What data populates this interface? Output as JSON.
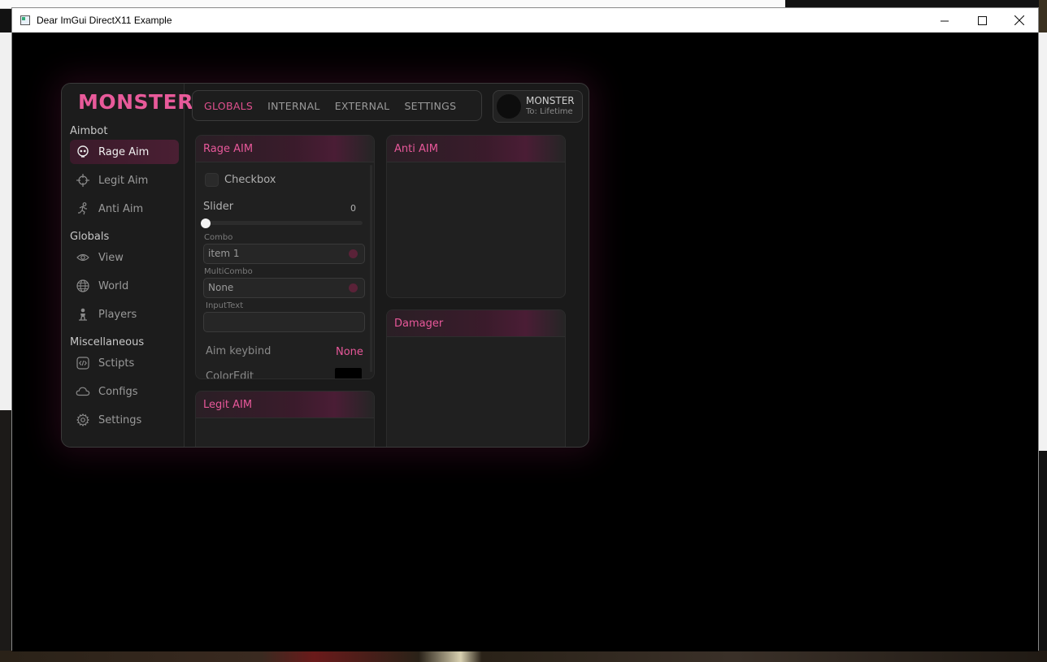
{
  "window": {
    "title": "Dear ImGui DirectX11 Example",
    "min_glyph": "—",
    "max_glyph": "☐",
    "close_glyph": "✕"
  },
  "brand": {
    "logo": "MONSTER",
    "accent": "#e8589a"
  },
  "sidebar": {
    "sections": [
      {
        "label": "Aimbot",
        "items": [
          {
            "label": "Rage Aim",
            "icon": "skull-icon",
            "active": true
          },
          {
            "label": "Legit Aim",
            "icon": "crosshair-icon"
          },
          {
            "label": "Anti Aim",
            "icon": "running-man-icon"
          }
        ]
      },
      {
        "label": "Globals",
        "items": [
          {
            "label": "View",
            "icon": "eye-icon"
          },
          {
            "label": "World",
            "icon": "globe-icon"
          },
          {
            "label": "Players",
            "icon": "person-icon"
          }
        ]
      },
      {
        "label": "Miscellaneous",
        "items": [
          {
            "label": "Sctipts",
            "icon": "code-icon"
          },
          {
            "label": "Configs",
            "icon": "cloud-icon"
          },
          {
            "label": "Settings",
            "icon": "gear-icon"
          }
        ]
      }
    ]
  },
  "tabs": [
    {
      "label": "GLOBALS",
      "active": true
    },
    {
      "label": "INTERNAL"
    },
    {
      "label": "EXTERNAL"
    },
    {
      "label": "SETTINGS"
    }
  ],
  "profile": {
    "name": "MONSTER",
    "subscription": "To: Lifetime"
  },
  "rage_aim": {
    "title": "Rage AIM",
    "checkbox_label": "Checkbox",
    "slider_label": "Slider",
    "slider_value": "0",
    "combo_label": "Combo",
    "combo_value": "item 1",
    "multicombo_label": "MultiCombo",
    "multicombo_value": "None",
    "inputtext_label": "InputText",
    "inputtext_value": "",
    "keybind_label": "Aim keybind",
    "keybind_value": "None",
    "coloredit_label": "ColorEdit"
  },
  "anti_aim": {
    "title": "Anti AIM"
  },
  "damager": {
    "title": "Damager"
  },
  "legit_aim": {
    "title": "Legit AIM"
  }
}
